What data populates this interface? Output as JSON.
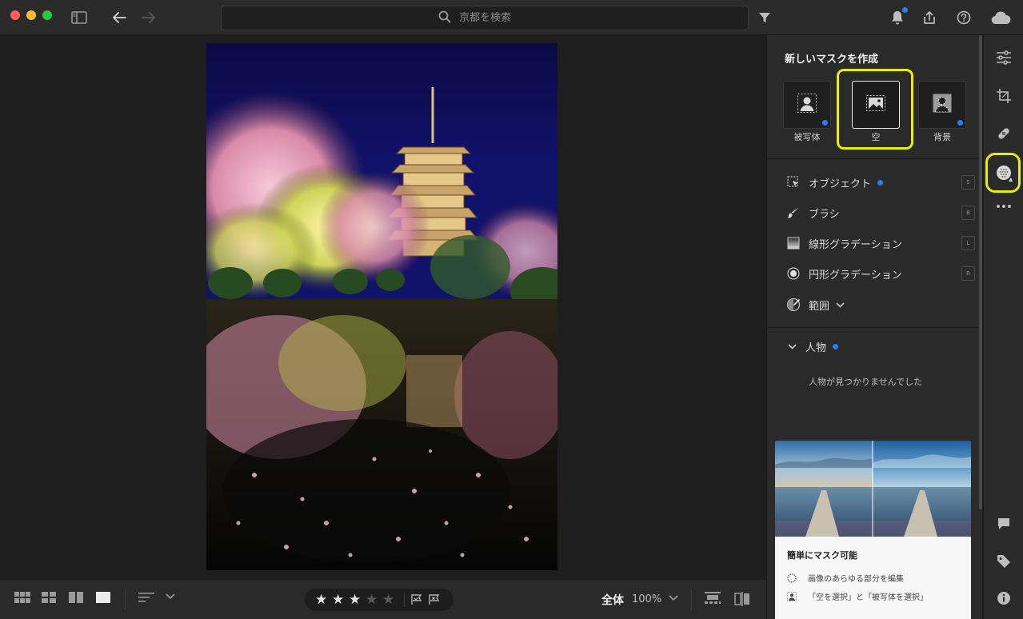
{
  "titlebar": {
    "search_placeholder": "京都を検索",
    "icons": [
      "sidebar-toggle-icon",
      "back-arrow-icon",
      "forward-arrow-icon",
      "search-icon",
      "filter-icon",
      "bell-icon",
      "share-icon",
      "help-icon",
      "cloud-icon"
    ]
  },
  "mask_panel": {
    "title": "新しいマスクを作成",
    "tiles": [
      {
        "label": "被写体",
        "icon": "subject-icon",
        "badge": true
      },
      {
        "label": "空",
        "icon": "sky-icon",
        "badge": false,
        "selected": true
      },
      {
        "label": "背景",
        "icon": "background-icon",
        "badge": true
      }
    ],
    "tools": [
      {
        "label": "オブジェクト",
        "shortcut": "S",
        "icon": "object-select-icon",
        "badge": true
      },
      {
        "label": "ブラシ",
        "shortcut": "B",
        "icon": "brush-icon",
        "badge": false
      },
      {
        "label": "線形グラデーション",
        "shortcut": "L",
        "icon": "linear-gradient-icon",
        "badge": false
      },
      {
        "label": "円形グラデーション",
        "shortcut": "R",
        "icon": "radial-gradient-icon",
        "badge": false
      }
    ],
    "range_label": "範囲",
    "people_section": {
      "label": "人物",
      "empty_text": "人物が見つかりませんでした"
    },
    "card": {
      "title": "簡単にマスク可能",
      "line1": "画像のあらゆる部分を編集",
      "line2": "「空を選択」と「被写体を選択」"
    }
  },
  "bottombar": {
    "rating": {
      "value": 3,
      "max": 5
    },
    "zoom_label": "全体",
    "zoom_value": "100%"
  },
  "colors": {
    "accent": "#2b7df0",
    "highlight": "#e6f000",
    "panel_bg": "#2a2a2a"
  }
}
